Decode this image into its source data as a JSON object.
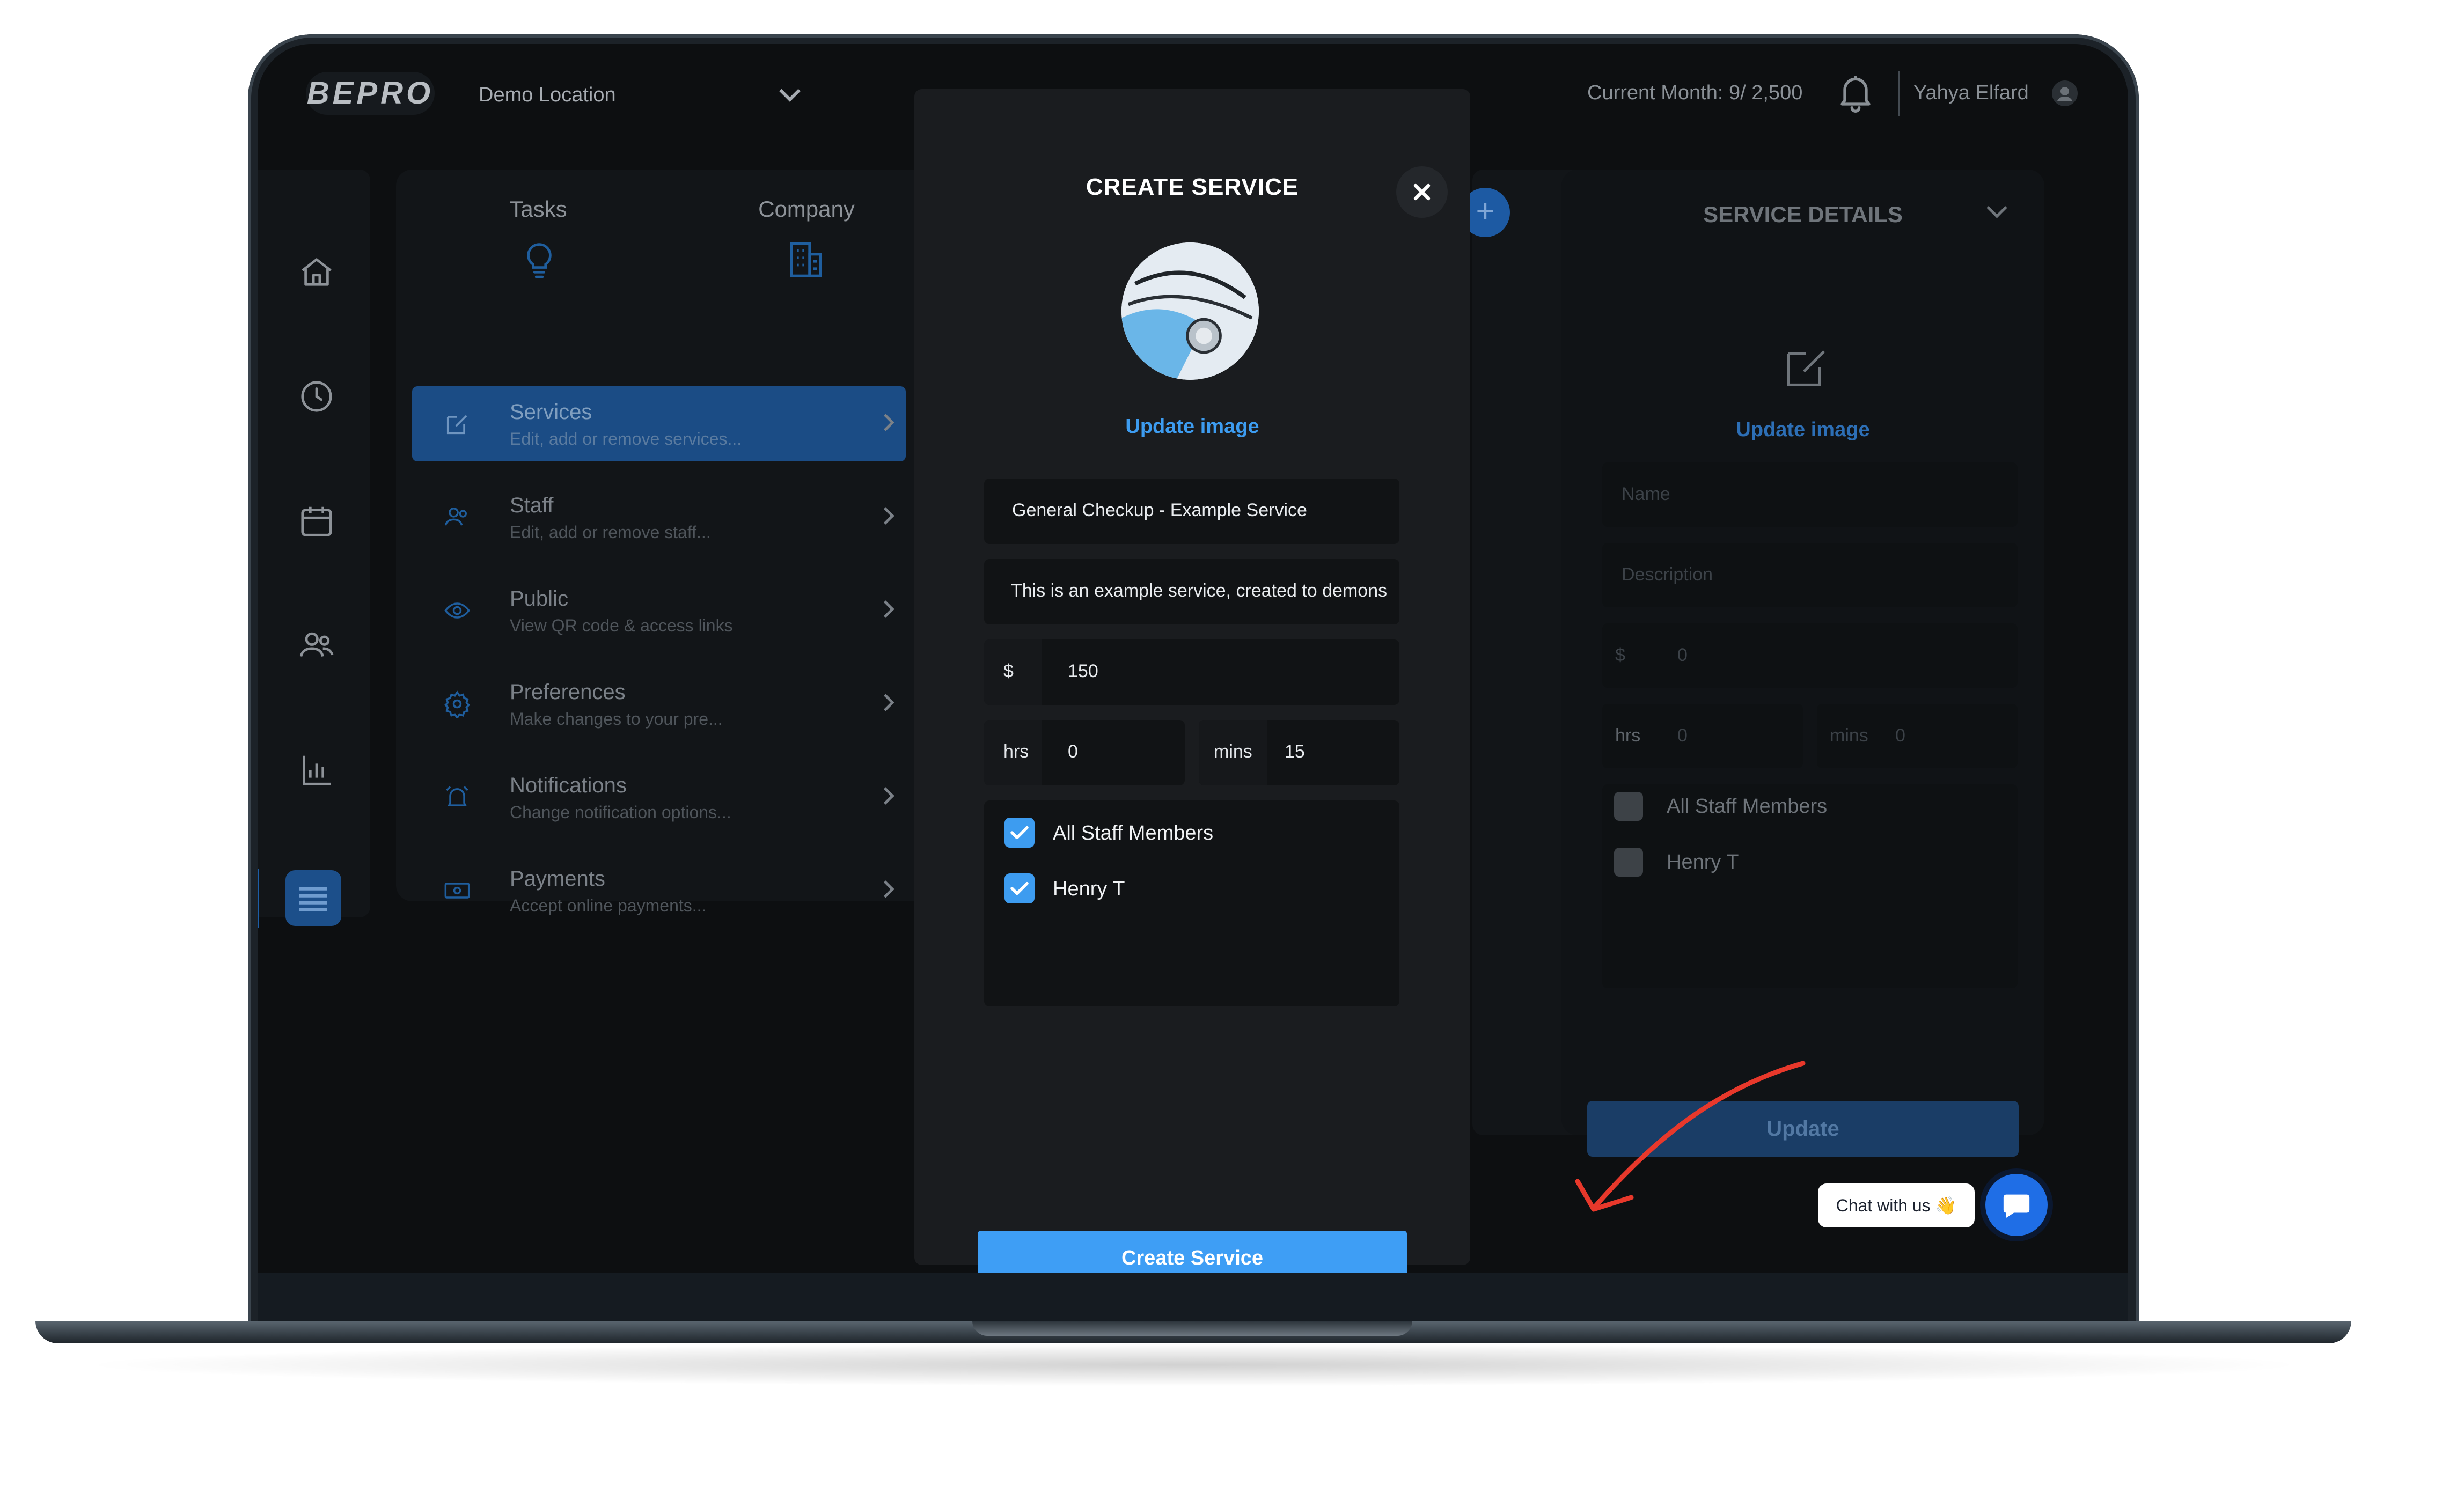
{
  "header": {
    "logo": "BEPRO",
    "location": "Demo Location",
    "current_month": "Current Month: 9/ 2,500",
    "user_name": "Yahya Elfard"
  },
  "rail": {
    "items": [
      "home-icon",
      "clock-icon",
      "calendar-icon",
      "users-icon",
      "chart-icon",
      "list-icon"
    ],
    "active": "list-icon"
  },
  "settings": {
    "tabs": [
      {
        "label": "Tasks",
        "icon": "lightbulb-icon"
      },
      {
        "label": "Company",
        "icon": "building-icon"
      }
    ],
    "menu": [
      {
        "title": "Services",
        "subtitle": "Edit, add or remove services...",
        "icon": "edit-icon",
        "active": true
      },
      {
        "title": "Staff",
        "subtitle": "Edit, add or remove staff...",
        "icon": "users-icon"
      },
      {
        "title": "Public",
        "subtitle": "View QR code & access links",
        "icon": "eye-icon"
      },
      {
        "title": "Preferences",
        "subtitle": "Make changes to your pre...",
        "icon": "gear-icon"
      },
      {
        "title": "Notifications",
        "subtitle": "Change notification options...",
        "icon": "alarm-icon"
      },
      {
        "title": "Payments",
        "subtitle": "Accept online payments...",
        "icon": "money-icon"
      }
    ]
  },
  "modal": {
    "title": "CREATE SERVICE",
    "update_image": "Update image",
    "name_value": "General Checkup - Example Service",
    "description_value": "This is an example service, created to demons",
    "price_prefix": "$",
    "price_value": "150",
    "hrs_label": "hrs",
    "hrs_value": "0",
    "mins_label": "mins",
    "mins_value": "15",
    "staff": [
      {
        "label": "All Staff Members",
        "checked": true
      },
      {
        "label": "Henry T",
        "checked": true
      }
    ],
    "create_button": "Create Service"
  },
  "details": {
    "title": "SERVICE DETAILS",
    "update_image": "Update image",
    "name_placeholder": "Name",
    "description_placeholder": "Description",
    "price_prefix": "$",
    "price_placeholder": "0",
    "hrs_label": "hrs",
    "hrs_placeholder": "0",
    "mins_label": "mins",
    "mins_placeholder": "0",
    "staff": [
      {
        "label": "All Staff Members",
        "checked": false
      },
      {
        "label": "Henry T",
        "checked": false
      }
    ],
    "update_button": "Update"
  },
  "chat": {
    "label": "Chat with us 👋"
  },
  "colors": {
    "accent": "#3e9ef5",
    "active_menu": "#1b4c85",
    "annotation_arrow": "#e8382b"
  }
}
